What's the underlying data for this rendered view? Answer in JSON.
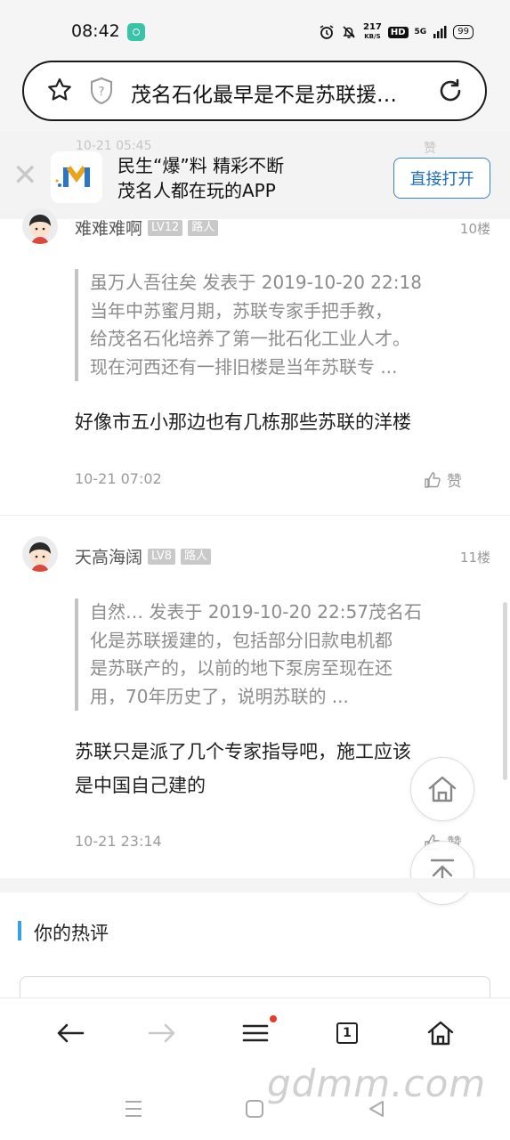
{
  "status_bar": {
    "time": "08:42",
    "speed_value": "217",
    "speed_unit": "KB/S",
    "hd": "HD",
    "signal": "5G",
    "battery": "99"
  },
  "url_bar": {
    "title": "茂名石化最早是不是苏联援…"
  },
  "banner": {
    "ghost_time": "10-21 05:45",
    "ghost_like": "赞",
    "line1": "民生“爆”料 精彩不断",
    "line2": "茂名人都在玩的APP",
    "open_button": "直接打开"
  },
  "comments": [
    {
      "username": "难难难啊",
      "level": "LV12",
      "role": "路人",
      "floor": "10楼",
      "quote_lines": [
        "虽万人吾往矣 发表于 2019-10-20 22:18",
        "当年中苏蜜月期，苏联专家手把手教，",
        "给茂名石化培养了第一批石化工业人才。",
        "现在河西还有一排旧楼是当年苏联专 ..."
      ],
      "text_lines": [
        "好像市五小那边也有几栋那些苏联的洋楼"
      ],
      "time": "10-21 07:02",
      "like": "赞"
    },
    {
      "username": "天高海阔",
      "level": "LV8",
      "role": "路人",
      "floor": "11楼",
      "quote_lines": [
        "自然… 发表于 2019-10-20 22:57茂名石",
        "化是苏联援建的，包括部分旧款电机都",
        "是苏联产的，以前的地下泵房至现在还",
        "用，70年历史了，说明苏联的 ..."
      ],
      "text_lines": [
        "苏联只是派了几个专家指导吧，施工应该",
        "是中国自己建的"
      ],
      "time": "10-21 23:14",
      "like": "赞"
    }
  ],
  "hot_section": {
    "title": "你的热评"
  },
  "toolbar": {
    "tab_count": "1"
  },
  "watermark": "gdmm.com",
  "icons": {
    "url_left": "star-icon",
    "url_security": "shield-question-icon",
    "url_right": "reload-icon",
    "fab_home": "home-icon",
    "fab_top": "back-to-top-icon"
  },
  "colors": {
    "accent_blue": "#36a3e6",
    "button_blue": "#1f6fbf",
    "notification_dot": "#e63b2e"
  }
}
